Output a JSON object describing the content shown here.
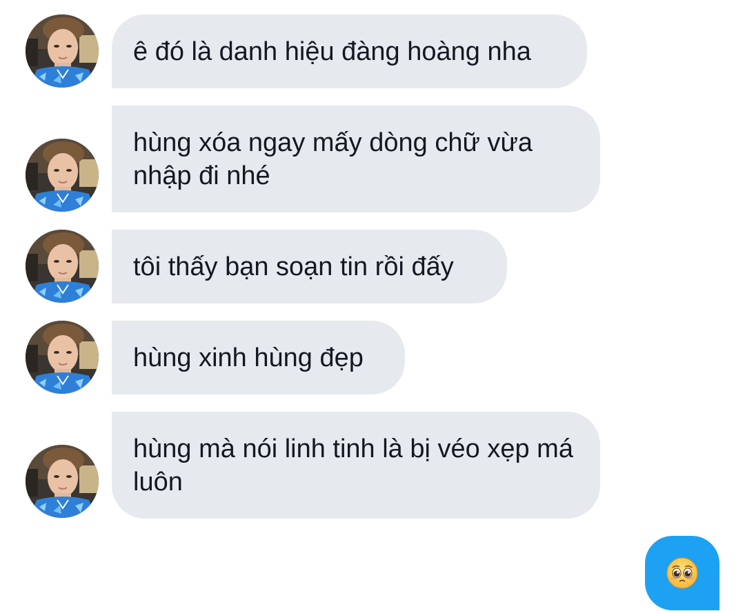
{
  "messages": [
    {
      "text": "ê đó là danh hiệu đàng hoàng nha"
    },
    {
      "text": "hùng xóa ngay mấy dòng chữ vừa nhập đi nhé"
    },
    {
      "text": "tôi thấy bạn soạn tin rồi đấy"
    },
    {
      "text": "hùng xinh hùng đẹp"
    },
    {
      "text": "hùng mà nói linh tinh là bị véo xẹp má luôn"
    }
  ],
  "sent": {
    "emoji": "pleading-face-emoji"
  },
  "colors": {
    "received_bubble": "#e6eaee",
    "received_text": "#141823",
    "sent_bubble": "#1da1f2",
    "background": "#ffffff"
  }
}
